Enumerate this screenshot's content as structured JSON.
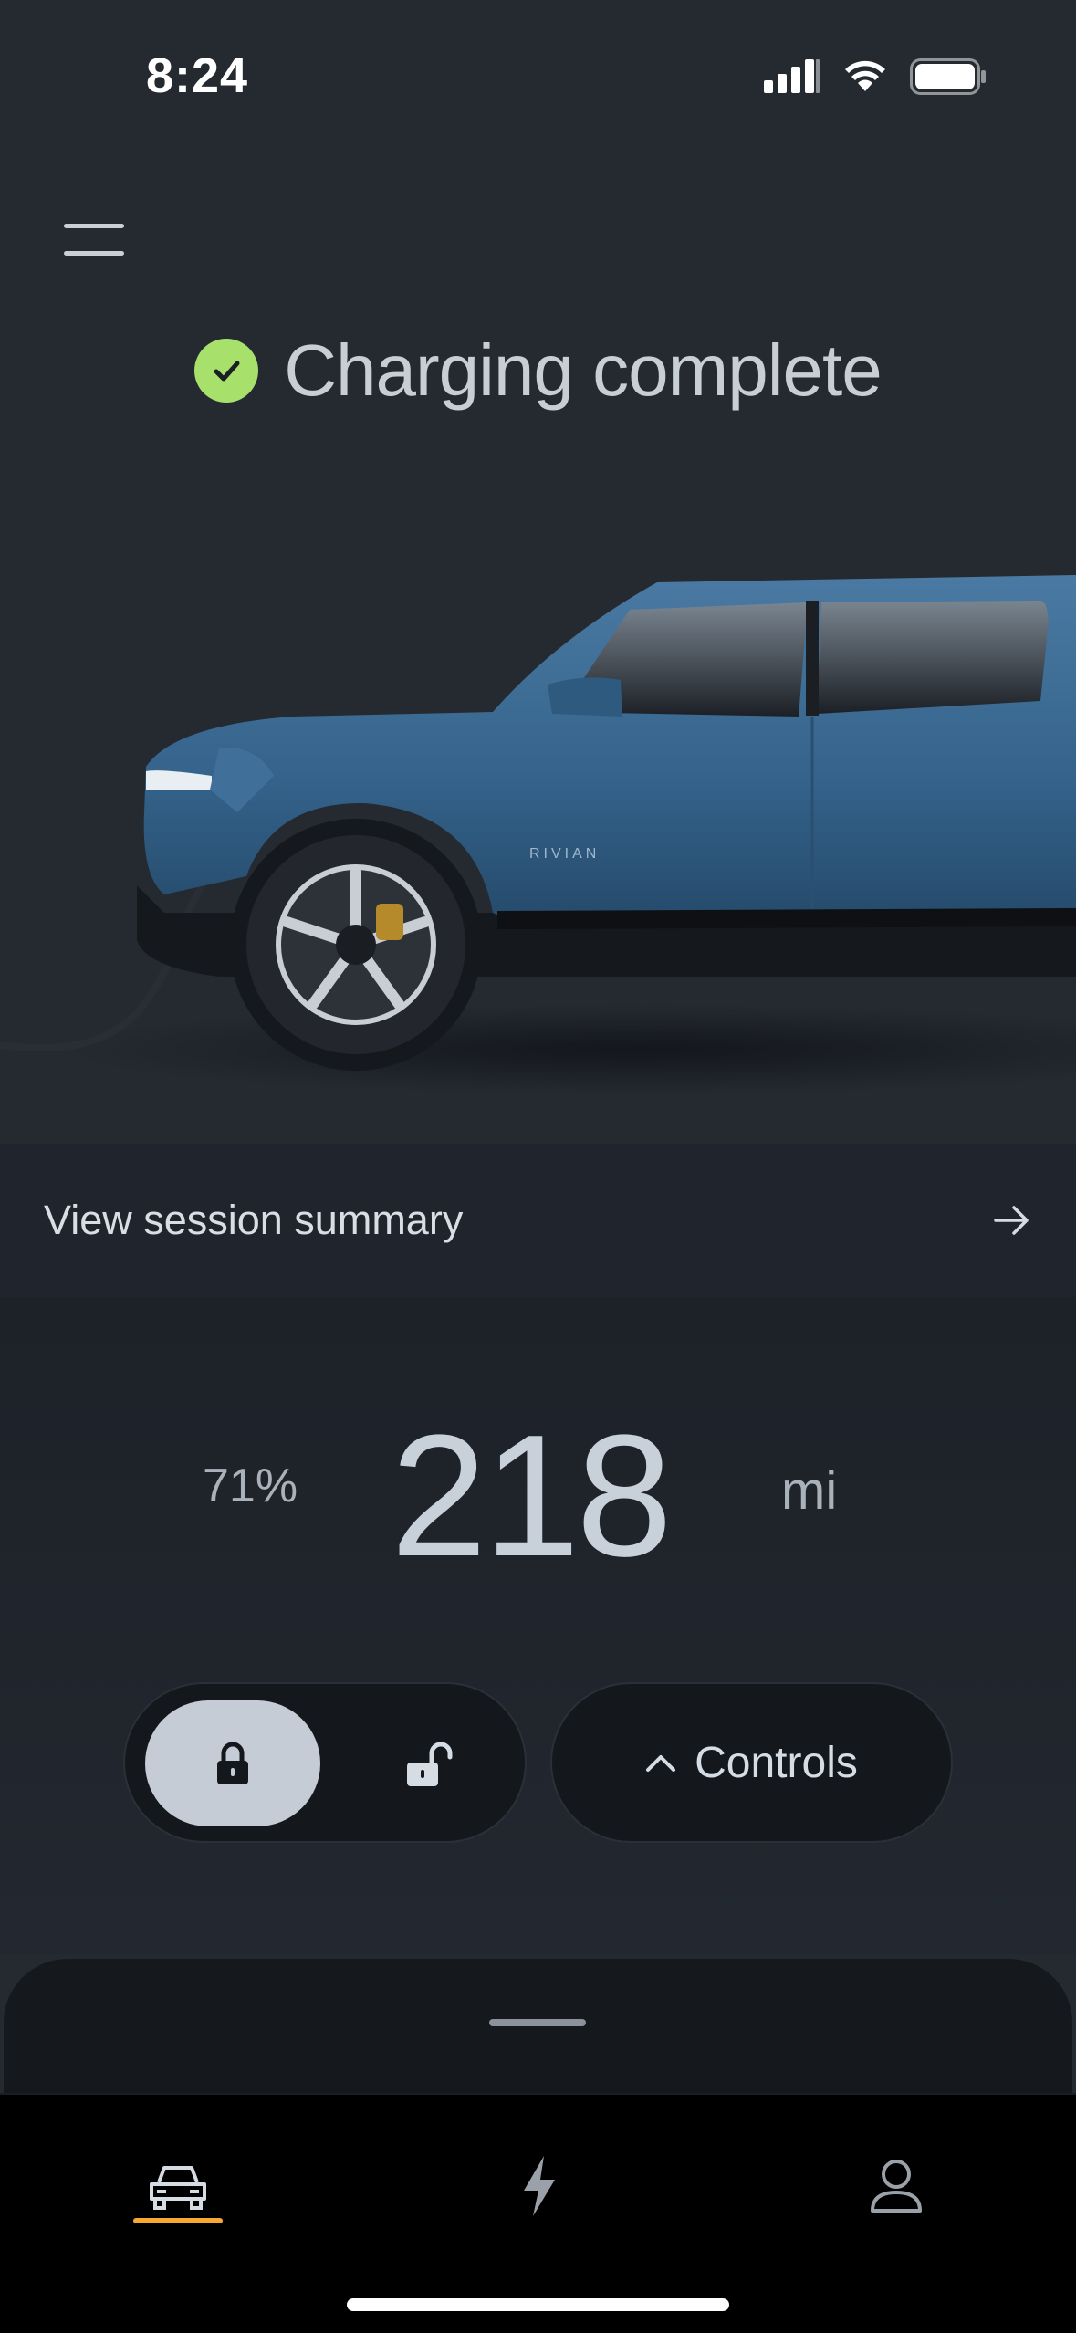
{
  "status_bar": {
    "time": "8:24"
  },
  "header": {
    "title": "Charging complete"
  },
  "vehicle": {
    "badge": "RIVIAN"
  },
  "session": {
    "label": "View session summary"
  },
  "range": {
    "battery_percent": "71%",
    "value": "218",
    "unit": "mi"
  },
  "controls": {
    "label": "Controls"
  },
  "colors": {
    "accent": "#f7a92f",
    "success": "#a7e06a",
    "truck_body": "#3b6a91",
    "background": "#252a31"
  },
  "icons": {
    "menu": "hamburger-icon",
    "check": "check-circle-icon",
    "arrow": "arrow-right-icon",
    "lock": "lock-icon",
    "unlock": "unlock-icon",
    "chevron": "chevron-up-icon",
    "vehicle_tab": "car-icon",
    "charging_tab": "lightning-icon",
    "profile_tab": "person-icon"
  },
  "tabs": {
    "active": "vehicle"
  }
}
